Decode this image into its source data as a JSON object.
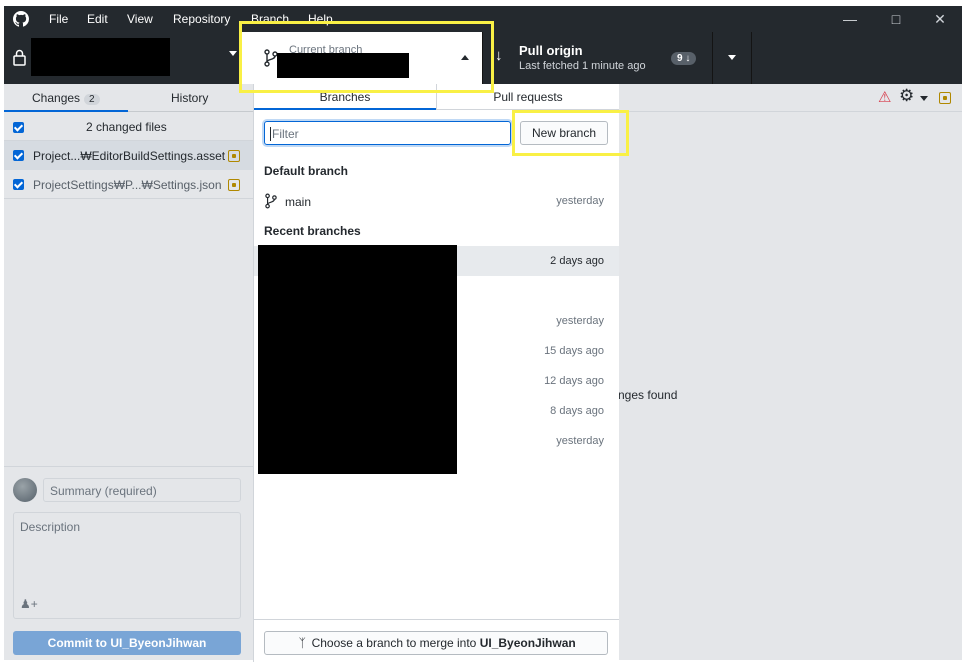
{
  "menu": [
    "File",
    "Edit",
    "View",
    "Repository",
    "Branch",
    "Help"
  ],
  "window_controls": [
    "minimize-icon",
    "maximize-icon",
    "close-icon"
  ],
  "toolbar": {
    "current_branch_label": "Current branch",
    "pull_title": "Pull origin",
    "pull_subtitle": "Last fetched 1 minute ago",
    "pull_count": "9 ↓"
  },
  "left_tabs": {
    "changes": "Changes",
    "changes_count": "2",
    "history": "History"
  },
  "changes": {
    "summary": "2 changed files",
    "files": [
      "Project...₩EditorBuildSettings.asset",
      "ProjectSettings₩P...₩Settings.json"
    ]
  },
  "commit": {
    "summary_placeholder": "Summary (required)",
    "description_placeholder": "Description",
    "button_label": "Commit to UI_ByeonJihwan"
  },
  "dropdown": {
    "tabs": [
      "Branches",
      "Pull requests"
    ],
    "filter_placeholder": "Filter",
    "new_branch": "New branch",
    "default_header": "Default branch",
    "default_branch": {
      "name": "main",
      "time": "yesterday"
    },
    "recent_header": "Recent branches",
    "recent_times": [
      "2 days ago",
      "yesterday",
      "15 days ago",
      "12 days ago",
      "8 days ago",
      "yesterday"
    ],
    "merge_prefix": "Choose a branch to merge into ",
    "merge_target": "UI_ByeonJihwan"
  },
  "right_pane": {
    "partial_text": "nges found"
  },
  "colors": {
    "dark": "#24292e",
    "accent": "#0366d6",
    "highlight": "#f9f045",
    "warning": "#d73a49"
  }
}
